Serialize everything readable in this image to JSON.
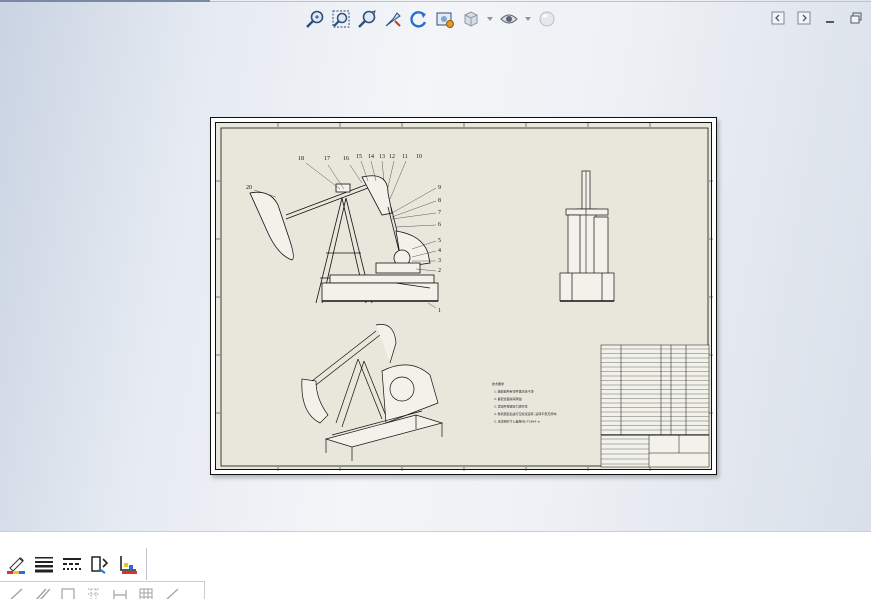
{
  "heads_up_toolbar": {
    "icons": [
      "zoom-to-fit-icon",
      "zoom-to-area-icon",
      "zoom-in-out-icon",
      "select-icon",
      "rotate-view-icon",
      "display-style-icon",
      "view-orientation-icon",
      "hide-show-icon",
      "appearance-icon"
    ]
  },
  "window_controls": [
    "tile-left-icon",
    "tile-right-icon",
    "minimize-icon",
    "restore-icon"
  ],
  "drawing": {
    "balloon_numbers": [
      "1",
      "2",
      "3",
      "4",
      "5",
      "6",
      "7",
      "8",
      "9",
      "10",
      "11",
      "12",
      "13",
      "14",
      "15",
      "16",
      "17",
      "18",
      "20"
    ],
    "technical_requirements": [
      "技术要求",
      "1.装配前所有零件需清洗干净",
      "2.各配合面涂润滑油",
      "3.紧固件按规定力矩拧紧",
      "4.整机装配后进行空载试运转,运转平稳无异响",
      "5.未注明尺寸公差按GB/T1804-m"
    ]
  },
  "command_manager": {
    "row1_icons": [
      "line-color-icon",
      "line-thickness-icon",
      "line-style-icon",
      "hide-show-edges-icon",
      "color-display-mode-icon"
    ],
    "row2_icons": [
      "sketch-line-icon",
      "parallel-line-icon",
      "corner-rectangle-icon",
      "grid-icon",
      "dimension-icon",
      "table-icon",
      "angle-icon"
    ]
  },
  "colors": {
    "sheet_background": "#e8e7dc",
    "viewport_gradient_left": "#c9d3e2",
    "accent_blue": "#2a6fcf"
  }
}
